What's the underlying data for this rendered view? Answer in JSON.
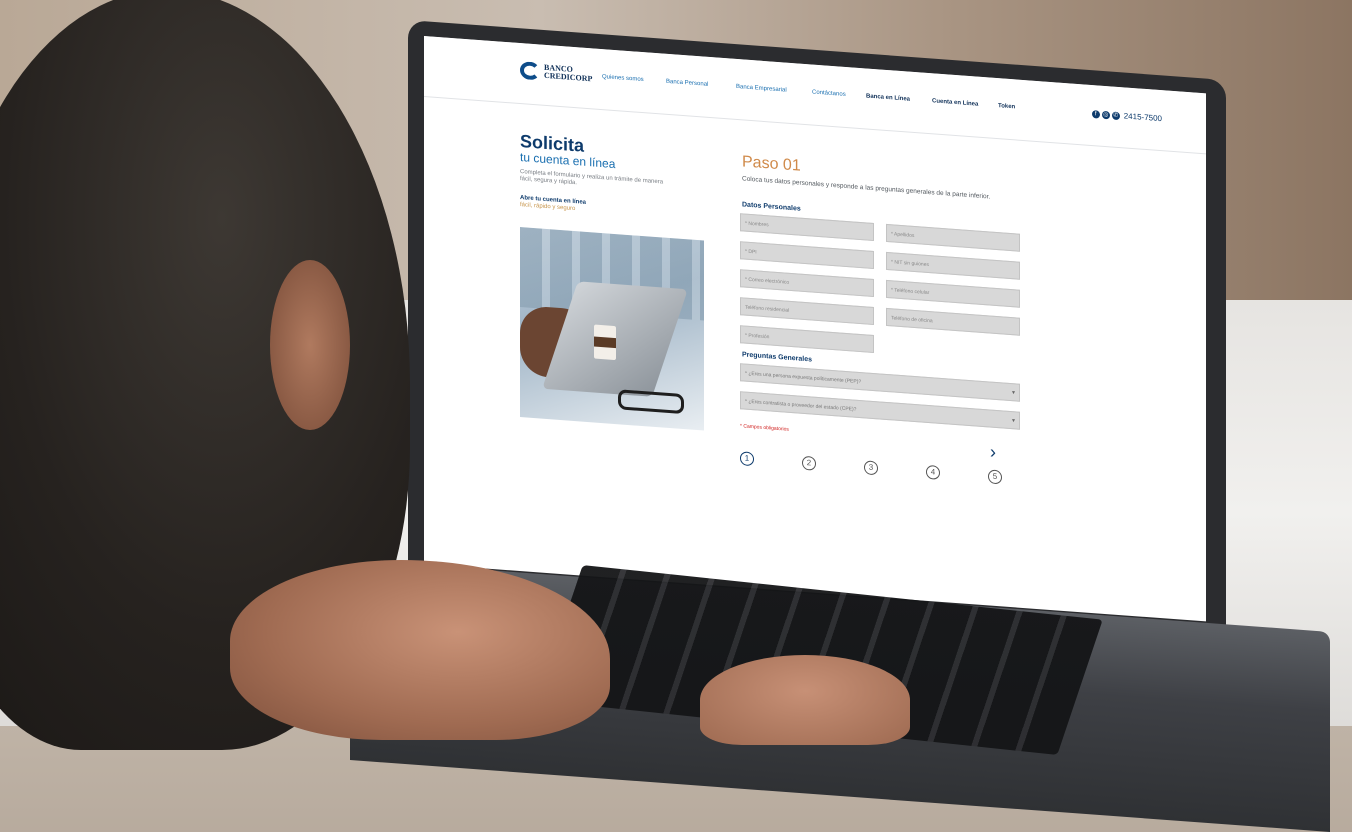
{
  "nav": {
    "logo": {
      "line1": "BANCO",
      "line2": "CREDICORP"
    },
    "links": [
      {
        "label": "Quienes somos",
        "bold": false
      },
      {
        "label": "Banca Personal",
        "bold": false
      },
      {
        "label": "Banca Empresarial",
        "bold": false
      },
      {
        "label": "Contáctanos",
        "bold": false
      },
      {
        "label": "Banca en Línea",
        "bold": true
      },
      {
        "label": "Cuenta en Línea",
        "bold": true
      },
      {
        "label": "Token",
        "bold": true
      }
    ],
    "social": [
      "f",
      "◎",
      "✆"
    ],
    "phone": "2415-7500"
  },
  "hero": {
    "title": "Solicita",
    "subtitle": "tu cuenta en línea",
    "description": "Completa el formulario y realiza un trámite de manera fácil, segura y rápida.",
    "link_title": "Abre tu cuenta en línea",
    "link_sub": "fácil, rápido y seguro"
  },
  "step": {
    "title": "Paso 01",
    "description": "Coloca tus datos personales y responde a las preguntas generales de la parte inferior."
  },
  "form": {
    "section_personal": "Datos Personales",
    "fields": [
      "* Nombres",
      "* Apellidos",
      "* DPI",
      "* NIT sin guiones",
      "* Correo electrónico",
      "* Teléfono celular",
      "Teléfono residencial",
      "Teléfono de oficina",
      "* Profesión"
    ],
    "section_general": "Preguntas Generales",
    "questions": [
      "* ¿Eres una persona expuesta políticamente (PEP)?",
      "* ¿Eres contratista o proveedor del estado (CPE)?"
    ],
    "required_note": "* Campos obligatorios",
    "next_symbol": "›"
  },
  "steps": [
    "1",
    "2",
    "3",
    "4",
    "5"
  ],
  "colors": {
    "brand_dark": "#0e3b6c",
    "brand_blue": "#1a6fb0",
    "accent_orange": "#d08a4a",
    "required_red": "#d0211f"
  }
}
